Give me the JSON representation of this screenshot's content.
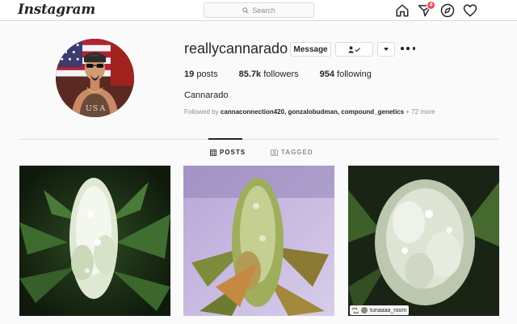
{
  "nav": {
    "logo": "Instagram",
    "search_placeholder": "Search",
    "notification_count": "4",
    "icons": [
      "home-icon",
      "direct-icon",
      "explore-icon",
      "activity-heart-icon"
    ]
  },
  "profile": {
    "username": "reallycannarado",
    "message_label": "Message",
    "following_icon": "person-check-icon",
    "dropdown_icon": "chevron-down-icon",
    "more_icon": "ellipsis-icon",
    "stats": [
      {
        "value": "19",
        "label": "posts"
      },
      {
        "value": "85.7k",
        "label": "followers"
      },
      {
        "value": "954",
        "label": "following"
      }
    ],
    "full_name": "Cannarado",
    "followed_by_prefix": "Followed by ",
    "followed_by_names": "cannaconnection420, gonzalobudman, compound_genetics",
    "followed_by_more": " + 72 more"
  },
  "tabs": [
    {
      "label": "POSTS",
      "icon": "grid-icon",
      "active": true
    },
    {
      "label": "TAGGED",
      "icon": "tag-portrait-icon",
      "active": false
    }
  ],
  "posts": [
    {
      "id": "post-1",
      "theme": "white-bud-green-leaves"
    },
    {
      "id": "post-2",
      "theme": "bud-purple-background"
    },
    {
      "id": "post-3",
      "theme": "frosty-bud-dark-background",
      "tag": "tunaaaa_room"
    }
  ],
  "colors": {
    "text": "#262626",
    "muted": "#8e8e8e",
    "border": "#dbdbdb",
    "badge": "#ed4956",
    "background": "#fafafa"
  }
}
